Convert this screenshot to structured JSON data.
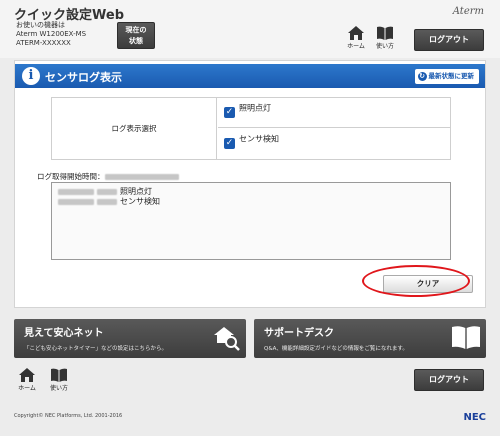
{
  "header": {
    "app_title": "クイック設定Web",
    "device_label": "お使いの機器は",
    "device_model": "Aterm W1200EX-MS",
    "device_id": "ATERM-XXXXXX",
    "status_button": "現在の\n状態",
    "brand": "Aterm",
    "home_label": "ホーム",
    "howto_label": "使い方",
    "logout_label": "ログアウト"
  },
  "section": {
    "title": "センサログ表示",
    "info_glyph": "i",
    "refresh_label": "最新状態に更新"
  },
  "log_select": {
    "label": "ログ表示選択",
    "options": [
      {
        "label": "照明点灯",
        "checked": true
      },
      {
        "label": "センサ検知",
        "checked": true
      }
    ]
  },
  "log": {
    "start_label": "ログ取得開始時間：",
    "entries": [
      "照明点灯",
      "センサ検知"
    ]
  },
  "clear_button": "クリア",
  "banners": [
    {
      "title": "見えて安心ネット",
      "desc": "「こども安心ネットタイマー」などの設定はこちらから。",
      "icon": "house-search-icon"
    },
    {
      "title": "サポートデスク",
      "desc": "Q&A、機能詳細設定ガイドなどの情報をご覧になれます。",
      "icon": "book-icon"
    }
  ],
  "footer": {
    "home_label": "ホーム",
    "howto_label": "使い方",
    "logout_label": "ログアウト",
    "copyright": "Copyright© NEC Platforms, Ltd. 2001-2016",
    "logo": "NEC"
  },
  "colors": {
    "accent": "#1a5ab0",
    "highlight": "#e0161b",
    "dark_button": "#3c3c3c"
  }
}
